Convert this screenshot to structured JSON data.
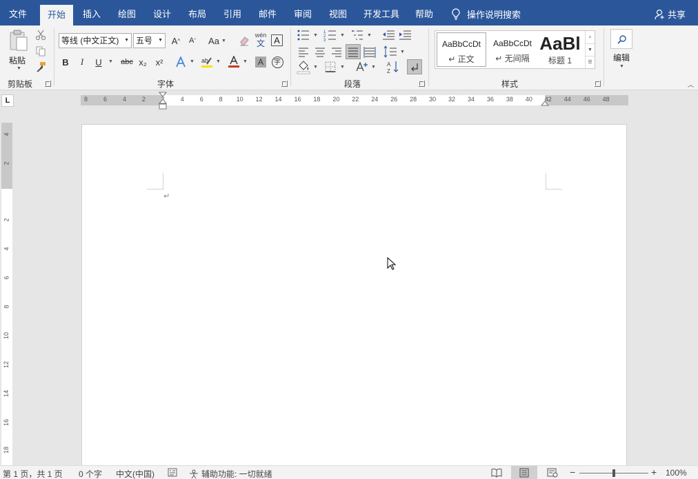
{
  "menubar": {
    "tabs": [
      {
        "label": "文件",
        "active": false
      },
      {
        "label": "开始",
        "active": true
      },
      {
        "label": "插入",
        "active": false
      },
      {
        "label": "绘图",
        "active": false
      },
      {
        "label": "设计",
        "active": false
      },
      {
        "label": "布局",
        "active": false
      },
      {
        "label": "引用",
        "active": false
      },
      {
        "label": "邮件",
        "active": false
      },
      {
        "label": "审阅",
        "active": false
      },
      {
        "label": "视图",
        "active": false
      },
      {
        "label": "开发工具",
        "active": false
      },
      {
        "label": "帮助",
        "active": false
      }
    ],
    "tell_me": "操作说明搜索",
    "share": "共享"
  },
  "ribbon": {
    "clipboard": {
      "paste_label": "粘贴",
      "group_label": "剪贴板"
    },
    "font": {
      "font_name": "等线 (中文正文)",
      "font_size": "五号",
      "change_case": "Aa",
      "phonetic_top": "wén",
      "phonetic_bottom": "文",
      "char_border": "A",
      "bold": "B",
      "italic": "I",
      "underline": "U",
      "strikethrough": "abc",
      "subscript": "x₂",
      "superscript": "x²",
      "enclose_char": "字",
      "group_label": "字体"
    },
    "paragraph": {
      "group_label": "段落"
    },
    "styles": {
      "items": [
        {
          "sample": "AaBbCcDt",
          "name": "↵ 正文"
        },
        {
          "sample": "AaBbCcDt",
          "name": "↵ 无间隔"
        },
        {
          "sample": "AaBl",
          "name": "标题 1"
        }
      ],
      "group_label": "样式"
    },
    "editing": {
      "label": "编辑"
    }
  },
  "ruler": {
    "tab_selector": "L",
    "h_numbers": [
      "8",
      "6",
      "4",
      "2",
      "2",
      "4",
      "6",
      "8",
      "10",
      "12",
      "14",
      "16",
      "18",
      "20",
      "22",
      "24",
      "26",
      "28",
      "30",
      "32",
      "34",
      "36",
      "38",
      "40",
      "42",
      "44",
      "46",
      "48"
    ],
    "v_numbers": [
      "4",
      "2",
      "2",
      "4",
      "6",
      "8",
      "10",
      "12",
      "14",
      "16",
      "18"
    ]
  },
  "document": {
    "paragraph_mark": "↵"
  },
  "statusbar": {
    "page": "第 1 页，共 1 页",
    "words": "0 个字",
    "language": "中文(中国)",
    "accessibility": "辅助功能: 一切就绪",
    "zoom_minus": "−",
    "zoom_plus": "+",
    "zoom": "100%",
    "zoom_level": 1.0
  },
  "colors": {
    "accent": "#2b579a",
    "ribbon_bg": "#f3f3f3",
    "canvas_bg": "#e6e6e6"
  }
}
